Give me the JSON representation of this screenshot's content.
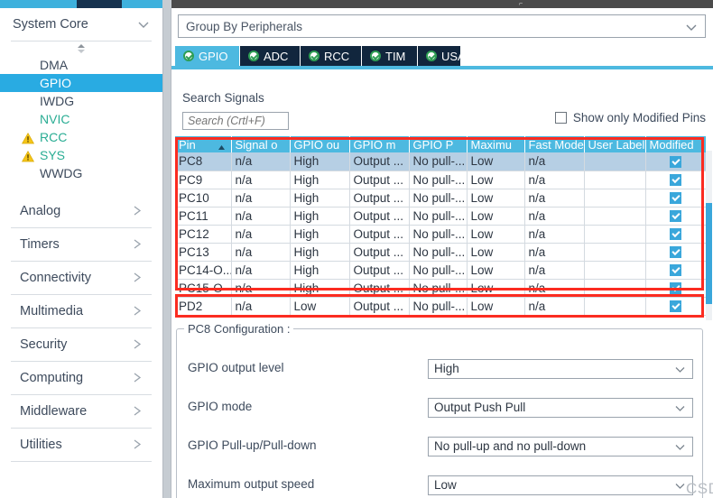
{
  "sidebar": {
    "header": {
      "title": "System Core",
      "chevron_icon": "chevron-down-icon"
    },
    "scroll_up_icon": "scroll-up-down-icon",
    "items": [
      {
        "label": "DMA",
        "selected": false,
        "warning": false,
        "green": false
      },
      {
        "label": "GPIO",
        "selected": true,
        "warning": false,
        "green": false
      },
      {
        "label": "IWDG",
        "selected": false,
        "warning": false,
        "green": false
      },
      {
        "label": "NVIC",
        "selected": false,
        "warning": false,
        "green": true
      },
      {
        "label": "RCC",
        "selected": false,
        "warning": true,
        "green": true
      },
      {
        "label": "SYS",
        "selected": false,
        "warning": true,
        "green": true
      },
      {
        "label": "WWDG",
        "selected": false,
        "warning": false,
        "green": false
      }
    ],
    "sections": [
      {
        "label": "Analog"
      },
      {
        "label": "Timers"
      },
      {
        "label": "Connectivity"
      },
      {
        "label": "Multimedia"
      },
      {
        "label": "Security"
      },
      {
        "label": "Computing"
      },
      {
        "label": "Middleware"
      },
      {
        "label": "Utilities"
      }
    ]
  },
  "pane": {
    "group_by": {
      "value": "Group By Peripherals",
      "chevron_icon": "chevron-down-icon"
    },
    "tabs": [
      {
        "label": "GPIO",
        "active": true,
        "status_icon": "check-circle-icon"
      },
      {
        "label": "ADC",
        "active": false,
        "status_icon": "check-circle-icon"
      },
      {
        "label": "RCC",
        "active": false,
        "status_icon": "check-circle-icon"
      },
      {
        "label": "TIM",
        "active": false,
        "status_icon": "check-circle-icon"
      },
      {
        "label": "USART",
        "active": false,
        "status_icon": "check-circle-icon"
      }
    ],
    "search": {
      "label": "Search Signals",
      "value": "",
      "placeholder": "Search (Crtl+F)",
      "icon": "search-icon"
    },
    "show_only_modified": {
      "label": "Show only Modified Pins",
      "checked": false
    }
  },
  "table": {
    "columns": [
      {
        "key": "pin",
        "label": "Pin",
        "sorted": true,
        "sort_icon": "sort-asc-icon"
      },
      {
        "key": "signal",
        "label": "Signal o",
        "sorted": false
      },
      {
        "key": "output",
        "label": "GPIO ou",
        "sorted": false
      },
      {
        "key": "mode",
        "label": "GPIO m",
        "sorted": false
      },
      {
        "key": "pull",
        "label": "GPIO P",
        "sorted": false
      },
      {
        "key": "maxspeed",
        "label": "Maximu",
        "sorted": false
      },
      {
        "key": "fastmode",
        "label": "Fast Mode",
        "sorted": false
      },
      {
        "key": "userlabel",
        "label": "User Label",
        "sorted": false
      },
      {
        "key": "modified",
        "label": "Modified",
        "sorted": false
      }
    ],
    "rows": [
      {
        "pin": "PC8",
        "signal": "n/a",
        "output": "High",
        "mode": "Output ...",
        "pull": "No pull-...",
        "maxspeed": "Low",
        "fastmode": "n/a",
        "userlabel": "",
        "modified": true,
        "selected": true
      },
      {
        "pin": "PC9",
        "signal": "n/a",
        "output": "High",
        "mode": "Output ...",
        "pull": "No pull-...",
        "maxspeed": "Low",
        "fastmode": "n/a",
        "userlabel": "",
        "modified": true,
        "selected": false
      },
      {
        "pin": "PC10",
        "signal": "n/a",
        "output": "High",
        "mode": "Output ...",
        "pull": "No pull-...",
        "maxspeed": "Low",
        "fastmode": "n/a",
        "userlabel": "",
        "modified": true,
        "selected": false
      },
      {
        "pin": "PC11",
        "signal": "n/a",
        "output": "High",
        "mode": "Output ...",
        "pull": "No pull-...",
        "maxspeed": "Low",
        "fastmode": "n/a",
        "userlabel": "",
        "modified": true,
        "selected": false
      },
      {
        "pin": "PC12",
        "signal": "n/a",
        "output": "High",
        "mode": "Output ...",
        "pull": "No pull-...",
        "maxspeed": "Low",
        "fastmode": "n/a",
        "userlabel": "",
        "modified": true,
        "selected": false
      },
      {
        "pin": "PC13",
        "signal": "n/a",
        "output": "High",
        "mode": "Output ...",
        "pull": "No pull-...",
        "maxspeed": "Low",
        "fastmode": "n/a",
        "userlabel": "",
        "modified": true,
        "selected": false
      },
      {
        "pin": "PC14-O...",
        "signal": "n/a",
        "output": "High",
        "mode": "Output ...",
        "pull": "No pull-...",
        "maxspeed": "Low",
        "fastmode": "n/a",
        "userlabel": "",
        "modified": true,
        "selected": false
      },
      {
        "pin": "PC15-O",
        "signal": "n/a",
        "output": "High",
        "mode": "Output ...",
        "pull": "No pull-...",
        "maxspeed": "Low",
        "fastmode": "n/a",
        "userlabel": "",
        "modified": true,
        "selected": false
      },
      {
        "pin": "PD2",
        "signal": "n/a",
        "output": "Low",
        "mode": "Output ...",
        "pull": "No pull-...",
        "maxspeed": "Low",
        "fastmode": "n/a",
        "userlabel": "",
        "modified": true,
        "selected": false
      }
    ]
  },
  "config": {
    "legend": "PC8 Configuration :",
    "rows": [
      {
        "label": "GPIO output level",
        "value": "High"
      },
      {
        "label": "GPIO mode",
        "value": "Output Push Pull"
      },
      {
        "label": "GPIO Pull-up/Pull-down",
        "value": "No pull-up and no pull-down"
      },
      {
        "label": "Maximum output speed",
        "value": "Low"
      }
    ]
  },
  "watermark": "CSDN @Epiphany暖风",
  "colors": {
    "accent_blue": "#29abe2",
    "table_header": "#4db9e0",
    "tab_bar_dark": "#11263d",
    "selected_row": "#b6cfe4",
    "annotation_red": "#fb2c21",
    "green_text": "#2aad94",
    "warning_yellow": "#f5c518"
  }
}
